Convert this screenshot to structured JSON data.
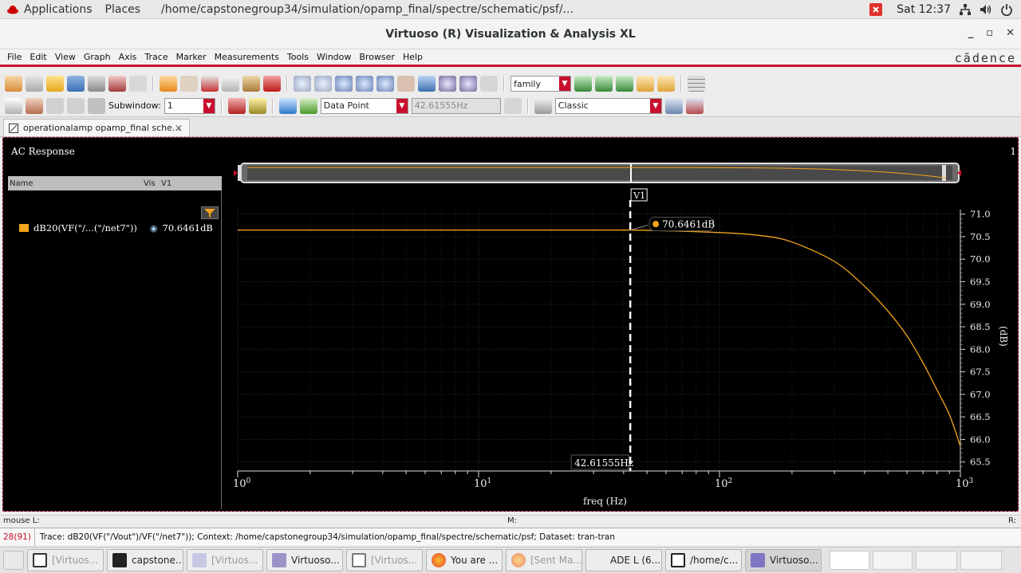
{
  "topbar": {
    "applications": "Applications",
    "places": "Places",
    "path": "/home/capstonegroup34/simulation/opamp_final/spectre/schematic/psf/...",
    "time": "Sat 12:37"
  },
  "window": {
    "title": "Virtuoso (R) Visualization & Analysis XL",
    "minimize": "_",
    "maximize": "▫",
    "close": "✕"
  },
  "menu": {
    "items": [
      "File",
      "Edit",
      "View",
      "Graph",
      "Axis",
      "Trace",
      "Marker",
      "Measurements",
      "Tools",
      "Window",
      "Browser",
      "Help"
    ],
    "brand": "cādence"
  },
  "toolbar1": {
    "family_value": "family"
  },
  "toolbar2": {
    "subwindow_label": "Subwindow:",
    "subwindow_value": "1",
    "marker_type_value": "Data Point",
    "marker_value_field": "42.61555Hz",
    "style_value": "Classic"
  },
  "tab": {
    "label": "operationalamp opamp_final sche..."
  },
  "plot": {
    "window_title": "AC Response",
    "corner_label": "1",
    "legend": {
      "col_name": "Name",
      "col_vis": "Vis",
      "col_v1": "V1",
      "trace_name": "dB20(VF(\"/...(\"/net7\"))",
      "trace_value": "70.6461dB"
    },
    "marker_label": "V1",
    "marker_value_label": "70.6461dB",
    "marker_x_label": "42.61555Hz",
    "trace_color": "#f3a41c"
  },
  "chart_data": {
    "type": "line",
    "title": "AC Response",
    "xlabel": "freq (Hz)",
    "ylabel": "(dB)",
    "xscale": "log",
    "xlim": [
      1,
      1000
    ],
    "ylim": [
      65.3,
      71.1
    ],
    "x_ticks": [
      "10^0",
      "10^1",
      "10^2",
      "10^3"
    ],
    "y_ticks": [
      "71.0",
      "70.5",
      "70.0",
      "69.5",
      "69.0",
      "68.5",
      "68.0",
      "67.5",
      "67.0",
      "66.5",
      "66.0",
      "65.5"
    ],
    "grid": true,
    "legend_position": "left-panel",
    "series": [
      {
        "name": "dB20(VF(\"/...(\"/net7\"))",
        "x": [
          1,
          10,
          42.61555,
          100,
          150,
          200,
          300,
          400,
          500,
          600,
          700,
          800,
          900,
          1000
        ],
        "values": [
          70.646,
          70.646,
          70.6461,
          70.59,
          70.52,
          70.38,
          69.95,
          69.4,
          68.85,
          68.3,
          67.7,
          67.1,
          66.55,
          65.85
        ]
      }
    ],
    "marker": {
      "name": "V1",
      "x": 42.61555,
      "y": 70.6461
    }
  },
  "status": {
    "mouse_left": "mouse L:",
    "mouse_mid": "M:",
    "mouse_right": "R:",
    "count": "28(91)",
    "message": "Trace: dB20(VF(\"/Vout\")/VF(\"/net7\")); Context: /home/capstonegroup34/simulation/opamp_final/spectre/schematic/psf; Dataset: tran-tran"
  },
  "taskbar": {
    "items": [
      "[Virtuos...",
      "capstone...",
      "[Virtuos...",
      "Virtuoso...",
      "[Virtuos...",
      "You are ...",
      "[Sent Ma...",
      "ADE L (6...",
      "/home/c...",
      "Virtuoso..."
    ]
  }
}
